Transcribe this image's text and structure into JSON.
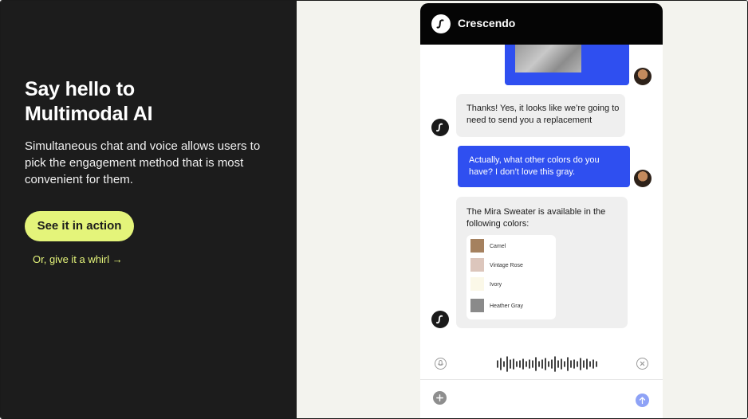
{
  "hero": {
    "title_line1": "Say hello to",
    "title_line2": "Multimodal AI",
    "description": "Simultaneous chat and voice allows users to pick the engagement method that is most convenient for them.",
    "cta_label": "See it in action",
    "secondary_link": "Or, give it a whirl →"
  },
  "phone": {
    "app_name": "Crescendo",
    "messages": [
      {
        "from": "bot",
        "text": "Thanks! Yes, it looks like we’re going to need to send you a replacement"
      },
      {
        "from": "user",
        "text": "Actually, what other colors do you have? I don’t love this gray."
      },
      {
        "from": "bot",
        "text": "The Mira Sweater is available in the following colors:"
      }
    ],
    "colors": [
      {
        "name": "Camel",
        "hex": "#a5815f"
      },
      {
        "name": "Vintage Rose",
        "hex": "#dcc6bc"
      },
      {
        "name": "Ivory",
        "hex": "#fbf8e8"
      },
      {
        "name": "Heather Gray",
        "hex": "#8a8a8a"
      }
    ]
  },
  "theme": {
    "accent": "#e4f47a",
    "user_bubble": "#2f4ff0",
    "dark_panel": "#1c1c1c"
  }
}
